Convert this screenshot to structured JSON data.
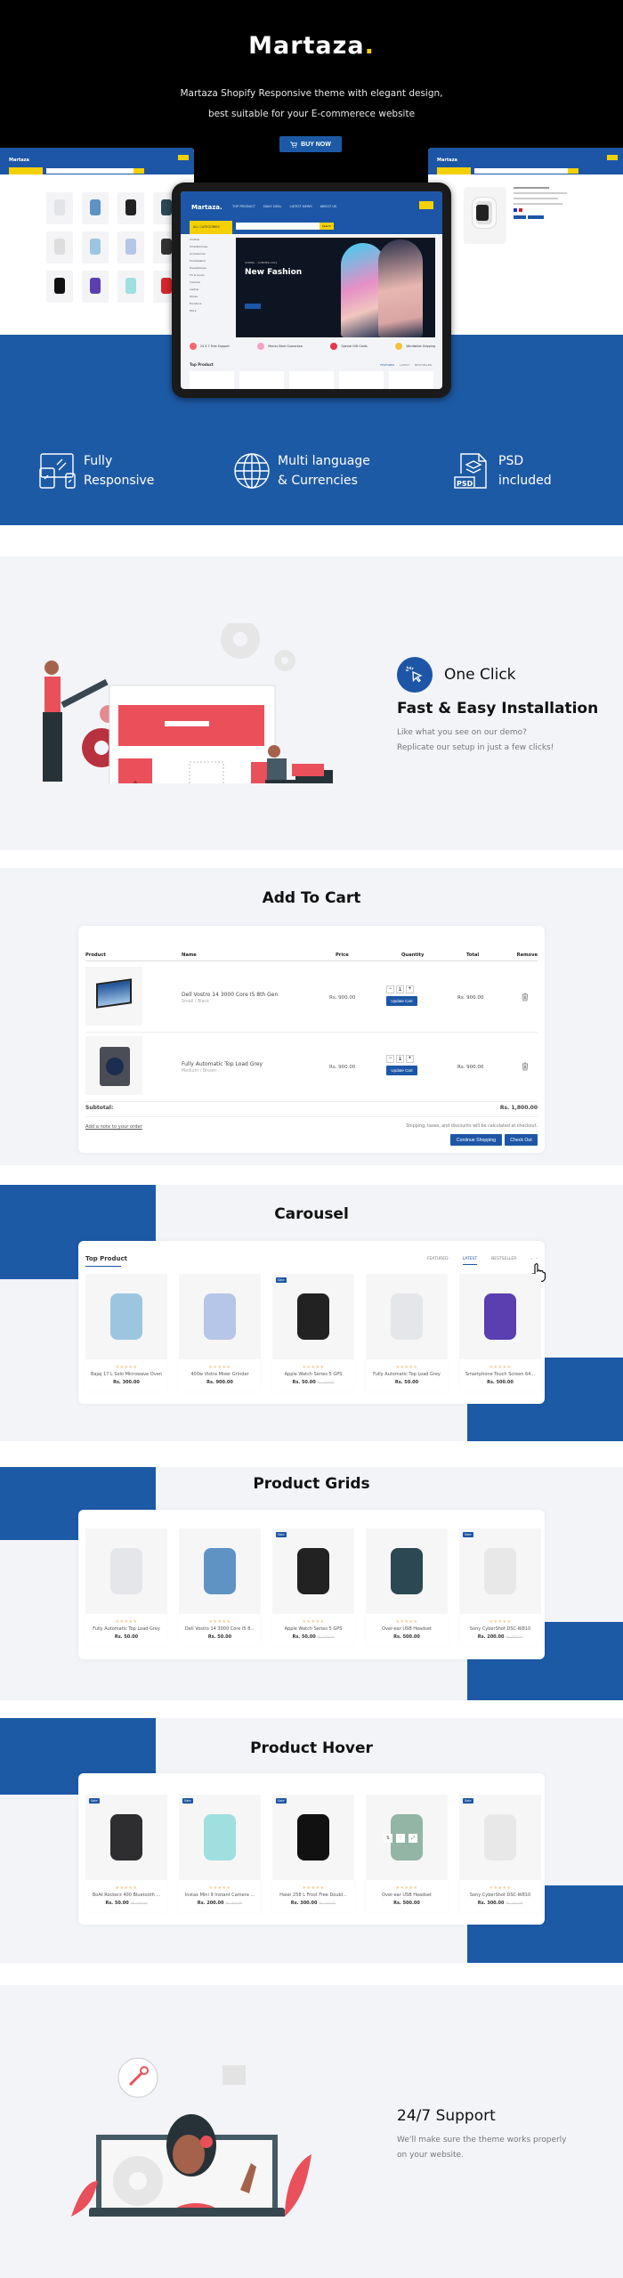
{
  "hero": {
    "brand": "Martaza",
    "brand_dot": ".",
    "tagline_line1": "Martaza Shopify Responsive theme with elegant design,",
    "tagline_line2": "best suitable for your E-commerece website",
    "buy_label": "BUY NOW",
    "tablet": {
      "logo": "Martaza.",
      "nav": [
        "TOP PRODUCT",
        "DAILY DEAL",
        "LATEST NEWS",
        "ABOUT US"
      ],
      "category_btn": "ALL CATEGORIES",
      "search_btn": "Search",
      "sidebar": [
        "Clothes",
        "Smartphones",
        "Accessories",
        "Smartwatch",
        "Headphones",
        "TV & Audio",
        "Camera",
        "Laptop",
        "Shoes",
        "Furniture",
        "More"
      ],
      "banner_small": "SPRING – SUMMER 2021",
      "banner_title": "New Fashion",
      "features": [
        "24 X 7 Free Support",
        "Money Back Guarantee",
        "Special Gift Cards",
        "Worldwide Shipping"
      ],
      "top_product": "Top Product",
      "tabs": [
        "FEATURED",
        "LATEST",
        "BESTSELLER"
      ]
    }
  },
  "features_band": [
    {
      "icon": "responsive-devices-icon",
      "line1": "Fully",
      "line2": "Responsive"
    },
    {
      "icon": "globe-icon",
      "line1": "Multi language",
      "line2": "& Currencies"
    },
    {
      "icon": "psd-file-icon",
      "line1": "PSD",
      "line2": "included"
    }
  ],
  "one_click": {
    "title": "One Click",
    "subtitle": "Fast & Easy Installation",
    "desc_line1": "Like what you see on our demo?",
    "desc_line2": "Replicate our setup in just a few clicks!"
  },
  "cart": {
    "title": "Add To Cart",
    "headers": [
      "Product",
      "Name",
      "Price",
      "Quantity",
      "Total",
      "Remove"
    ],
    "rows": [
      {
        "name": "Dell Vostro 14 3000 Core I5 8th Gen",
        "variant": "Small / Black",
        "price": "Rs. 900.00",
        "qty": "1",
        "total": "Rs. 900.00"
      },
      {
        "name": "Fully Automatic Top Load Grey",
        "variant": "Medium / Brown",
        "price": "Rs. 900.00",
        "qty": "1",
        "total": "Rs. 900.00"
      }
    ],
    "update_label": "Update Cart",
    "subtotal_label": "Subtotal:",
    "subtotal_value": "Rs. 1,800.00",
    "note_link": "Add a note to your order",
    "shipping_note": "Shipping, taxes, and discounts will be calculated at checkout.",
    "continue_label": "Continue Shopping",
    "checkout_label": "Check Out"
  },
  "carousel": {
    "title": "Carousel",
    "heading": "Top Product",
    "tabs": [
      "FEATURED",
      "LATEST",
      "BESTSELLER"
    ],
    "active_tab": "LATEST",
    "products": [
      {
        "name": "Bajaj 17 L Solo Microwave Oven",
        "price": "Rs. 300.00",
        "old": "",
        "sale": false,
        "color": "#9cc6e0"
      },
      {
        "name": "400w Vistra Mixer Grinder",
        "price": "Rs. 900.00",
        "old": "",
        "sale": false,
        "color": "#b6c6e8"
      },
      {
        "name": "Apple Watch Series 5 GPS",
        "price": "Rs. 50.00",
        "old": "Rs. 100.00",
        "sale": true,
        "color": "#222222"
      },
      {
        "name": "Fully Automatic Top Load Grey",
        "price": "Rs. 50.00",
        "old": "",
        "sale": false,
        "color": "#e4e6ea"
      },
      {
        "name": "Smartphone Touch Screen 64...",
        "price": "Rs. 500.00",
        "old": "",
        "sale": false,
        "color": "#5a3fb0"
      }
    ]
  },
  "grids": {
    "title": "Product Grids",
    "products": [
      {
        "name": "Fully Automatic Top Load Grey",
        "price": "Rs. 50.00",
        "old": "",
        "sale": false,
        "color": "#e4e6ea"
      },
      {
        "name": "Dell Vostro 14 3000 Core I5 8...",
        "price": "Rs. 50.00",
        "old": "",
        "sale": false,
        "color": "#5f93c4"
      },
      {
        "name": "Apple Watch Series 5 GPS",
        "price": "Rs. 50.00",
        "old": "Rs. 100.00",
        "sale": true,
        "color": "#222222"
      },
      {
        "name": "Over-ear USB Headset",
        "price": "Rs. 500.00",
        "old": "",
        "sale": false,
        "color": "#2c4852"
      },
      {
        "name": "Sony CyberShot DSC-W810",
        "price": "Rs. 200.00",
        "old": "Rs. 300.00",
        "sale": true,
        "color": "#e8e8e8"
      }
    ]
  },
  "hover": {
    "title": "Product Hover",
    "products": [
      {
        "name": "BoAt Rockerz 400 Bluetooth ...",
        "price": "Rs. 50.00",
        "old": "Rs. 100.00",
        "sale": true,
        "color": "#2e2e30"
      },
      {
        "name": "Instax Mini 9 Instant Camera ...",
        "price": "Rs. 200.00",
        "old": "Rs. 300.00",
        "sale": true,
        "color": "#9fdfe0"
      },
      {
        "name": "Haier 258 L Frost Free Doubl...",
        "price": "Rs. 300.00",
        "old": "Rs. 400.00",
        "sale": true,
        "color": "#111111"
      },
      {
        "name": "Over-ear USB Headset",
        "price": "Rs. 500.00",
        "old": "",
        "sale": false,
        "color": "#93b5a5"
      },
      {
        "name": "Sony CyberShot DSC-W810",
        "price": "Rs. 300.00",
        "old": "Rs. 400.00",
        "sale": true,
        "color": "#e8e8e8"
      }
    ],
    "sale_label": "Sale",
    "stars": "★★★★★"
  },
  "support": {
    "title": "24/7 Support",
    "desc_line1": "We'll make sure the theme works properly",
    "desc_line2": "on your website."
  },
  "colors": {
    "brand_blue": "#1d5aa6",
    "accent_yellow": "#f5d000",
    "illustration_red": "#e9505a"
  }
}
